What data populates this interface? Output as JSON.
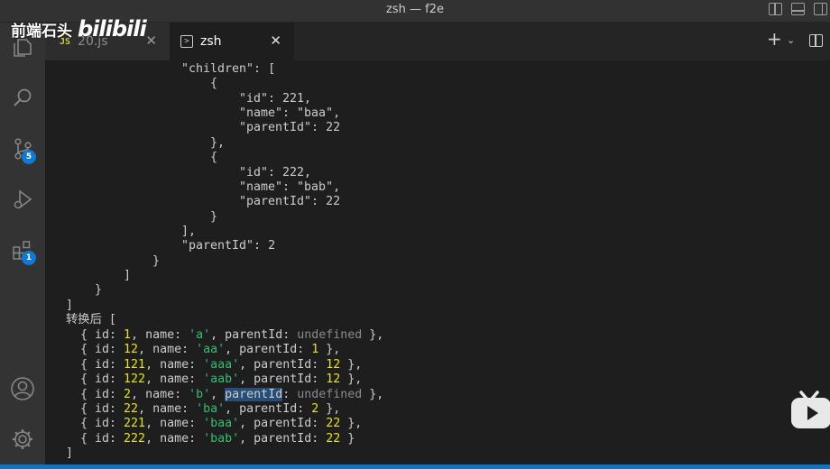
{
  "window": {
    "title": "zsh — f2e"
  },
  "watermark": {
    "text": "前端石头",
    "logo": "bilibili"
  },
  "activity": {
    "scm_badge": "5",
    "extensions_badge": "1"
  },
  "tabs": [
    {
      "badge": "JS",
      "label": "20.js"
    },
    {
      "label": "zsh"
    }
  ],
  "tab_close_glyph": "✕",
  "toolbar": {
    "new_terminal": "+",
    "dropdown": "⌄"
  },
  "terminal": {
    "pre_lines": [
      "\"children\": [",
      "{",
      "\"id\": 221,",
      "\"name\": \"baa\",",
      "\"parentId\": 22",
      "},",
      "{",
      "\"id\": 222,",
      "\"name\": \"bab\",",
      "\"parentId\": 22",
      "}",
      "],",
      "\"parentId\": 2",
      "}",
      "]",
      "}",
      "]"
    ],
    "result_label": "转换后 [",
    "rows": [
      {
        "id": "1",
        "name": "'a'",
        "parentId": "undefined"
      },
      {
        "id": "12",
        "name": "'aa'",
        "parentId": "1"
      },
      {
        "id": "121",
        "name": "'aaa'",
        "parentId": "12"
      },
      {
        "id": "122",
        "name": "'aab'",
        "parentId": "12"
      },
      {
        "id": "2",
        "name": "'b'",
        "parentId": "undefined"
      },
      {
        "id": "22",
        "name": "'ba'",
        "parentId": "2"
      },
      {
        "id": "221",
        "name": "'baa'",
        "parentId": "22"
      },
      {
        "id": "222",
        "name": "'bab'",
        "parentId": "22"
      }
    ],
    "closing": "]"
  }
}
